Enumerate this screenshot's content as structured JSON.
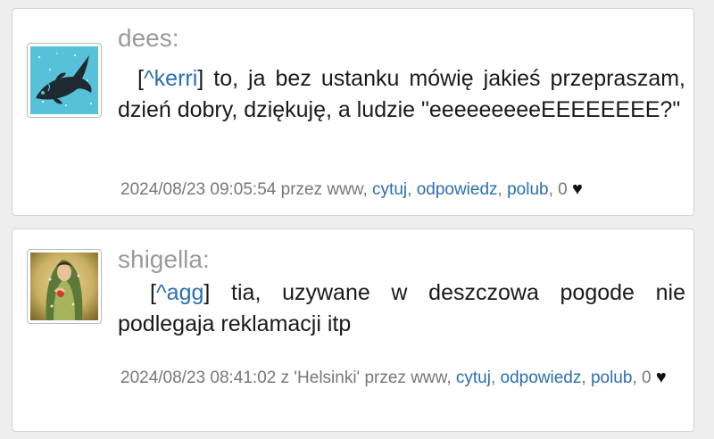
{
  "posts": [
    {
      "username": "dees:",
      "reply_tag_open": "[",
      "reply_to": "^kerri",
      "reply_tag_close": "]",
      "text": " to, ja bez ustanku mówię jakieś przepraszam, dzień dobry, dziękuję, a ludzie \"eeeeeeeeeEEEEEEEE?\"",
      "date": "2024/08/23 09:05:54",
      "location": "",
      "via": "przez www,",
      "quote_label": "cytuj",
      "reply_label": "odpowiedz",
      "like_label": "polub",
      "like_count": "0",
      "avatar_icon": "fish-icon"
    },
    {
      "username": "shigella:",
      "reply_tag_open": "[",
      "reply_to": "^agg",
      "reply_tag_close": "]",
      "text": " tia, uzywane w deszczowa pogode nie podlegaja reklamacji itp",
      "date": "2024/08/23 08:41:02",
      "location": "z 'Helsinki'",
      "via": "przez www,",
      "quote_label": "cytuj",
      "reply_label": "odpowiedz",
      "like_label": "polub",
      "like_count": "0",
      "avatar_icon": "painting-avatar"
    }
  ],
  "colors": {
    "link": "#2a6fb0",
    "username": "#9a9a9a",
    "meta": "#777777",
    "background": "#eeeeee",
    "fish_background": "#57c1d9"
  },
  "heart_glyph": "♥"
}
